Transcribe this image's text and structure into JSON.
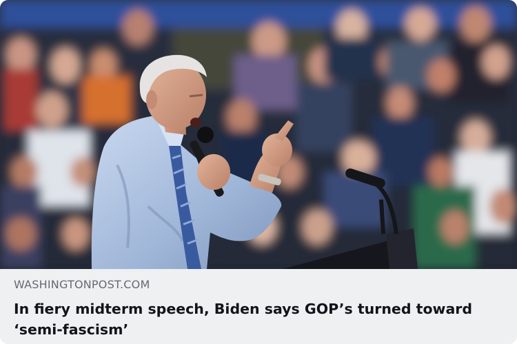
{
  "link_card": {
    "image_alt": "Joe Biden speaking into a microphone at a rally, pointing upward with a crowd behind him",
    "domain": "WASHINGTONPOST.COM",
    "headline": "In fiery midterm speech, Biden says GOP’s turned toward ‘semi-fascism’"
  },
  "colors": {
    "caption_background": "#eef0f2",
    "domain_text": "#666a70",
    "headline_text": "#111418"
  }
}
